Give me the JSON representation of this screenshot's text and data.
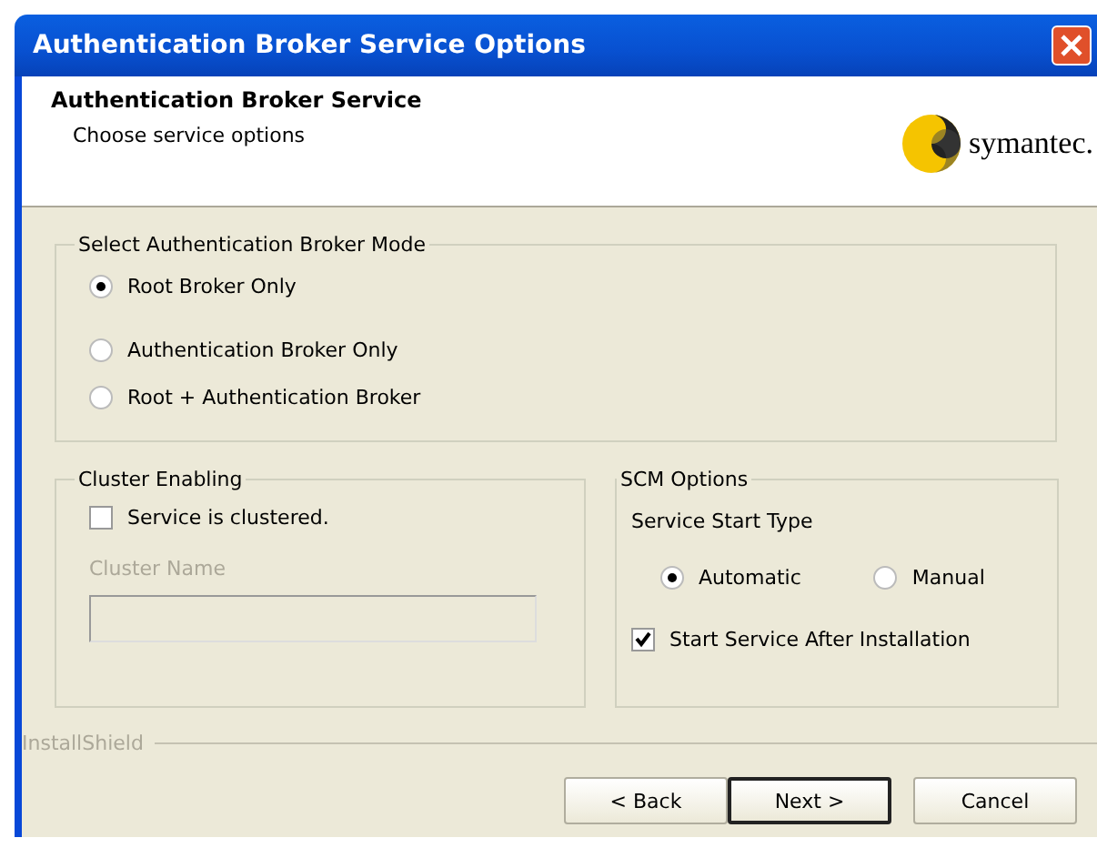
{
  "window": {
    "title": "Authentication Broker Service Options"
  },
  "header": {
    "title": "Authentication Broker Service",
    "subtitle": "Choose service options",
    "logo_text": "symantec."
  },
  "mode_group": {
    "title": "Select Authentication Broker Mode",
    "options": [
      {
        "label": "Root Broker Only",
        "selected": true
      },
      {
        "label": "Authentication Broker Only",
        "selected": false
      },
      {
        "label": "Root + Authentication Broker",
        "selected": false
      }
    ]
  },
  "cluster_group": {
    "title": "Cluster Enabling",
    "checkbox": {
      "label": "Service is clustered.",
      "checked": false
    },
    "field_label": "Cluster Name",
    "field_disabled": true
  },
  "scm_group": {
    "title": "SCM Options",
    "start_type_label": "Service Start Type",
    "start_types": [
      {
        "label": "Automatic",
        "selected": true
      },
      {
        "label": "Manual",
        "selected": false
      }
    ],
    "checkbox": {
      "label": "Start Service After Installation",
      "checked": true
    }
  },
  "footer_brand": "InstallShield",
  "buttons": [
    {
      "label": "< Back",
      "default": false
    },
    {
      "label": "Next >",
      "default": true
    },
    {
      "label": "Cancel",
      "default": false
    }
  ]
}
